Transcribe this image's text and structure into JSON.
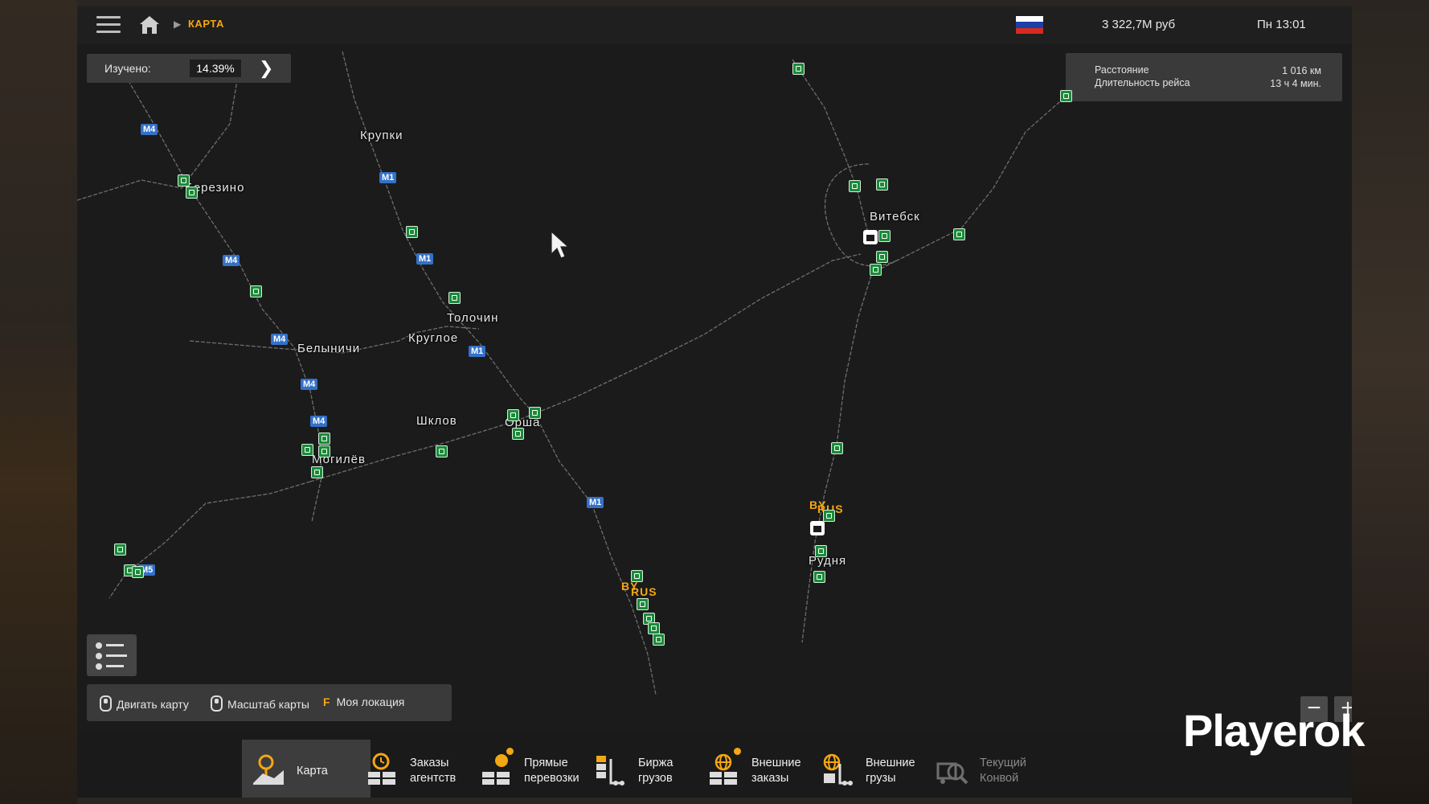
{
  "topbar": {
    "breadcrumb": "КАРТА",
    "money": "3 322,7M руб",
    "clock": "Пн 13:01",
    "flag_colors": [
      "#ffffff",
      "#1c3fa8",
      "#d52b1e"
    ]
  },
  "explored": {
    "label": "Изучено:",
    "value": "14.39%"
  },
  "route_info": {
    "distance_label": "Расстояние",
    "distance_value": "1 016 км",
    "duration_label": "Длительность рейса",
    "duration_value": "13 ч 4 мин."
  },
  "cities": [
    {
      "id": "krupki",
      "name": "Крупки"
    },
    {
      "id": "berezino",
      "name": "Березино"
    },
    {
      "id": "tolochin",
      "name": "Толочин"
    },
    {
      "id": "krugloe",
      "name": "Круглое"
    },
    {
      "id": "belynichi",
      "name": "Белыничи"
    },
    {
      "id": "shklov",
      "name": "Шклов"
    },
    {
      "id": "orsha",
      "name": "Орша"
    },
    {
      "id": "mogilev",
      "name": "Могилёв"
    },
    {
      "id": "vitebsk",
      "name": "Витебск"
    },
    {
      "id": "rudnya",
      "name": "Рудня"
    }
  ],
  "road_labels": [
    "M4",
    "M1",
    "M5"
  ],
  "border_labels": {
    "by": "BY",
    "rus": "RUS"
  },
  "hints": {
    "move_map": "Двигать карту",
    "zoom_map": "Масштаб карты",
    "my_location_key": "F",
    "my_location": "Моя локация"
  },
  "zoom": {
    "minus": "−",
    "plus": "+"
  },
  "watermark": "Playerok",
  "tabs": [
    {
      "id": "map",
      "label": "Карта",
      "active": true,
      "dot": false,
      "icon": "map-icon"
    },
    {
      "id": "agent-orders",
      "label": "Заказы\nагентств",
      "active": false,
      "dot": false,
      "icon": "agency-orders-icon"
    },
    {
      "id": "direct",
      "label": "Прямые\nперевозки",
      "active": false,
      "dot": true,
      "icon": "direct-transport-icon"
    },
    {
      "id": "freight",
      "label": "Биржа\nгрузов",
      "active": false,
      "dot": false,
      "icon": "freight-market-icon"
    },
    {
      "id": "ext-orders",
      "label": "Внешние\nзаказы",
      "active": false,
      "dot": true,
      "icon": "external-orders-icon"
    },
    {
      "id": "ext-cargo",
      "label": "Внешние\nгрузы",
      "active": false,
      "dot": false,
      "icon": "external-cargo-icon"
    },
    {
      "id": "convoy",
      "label": "Текущий\nКонвой",
      "active": false,
      "dot": false,
      "icon": "convoy-icon"
    }
  ],
  "colors": {
    "accent": "#f3a712",
    "road_badge": "#3471c8",
    "poi_green": "#1b8a3a"
  }
}
